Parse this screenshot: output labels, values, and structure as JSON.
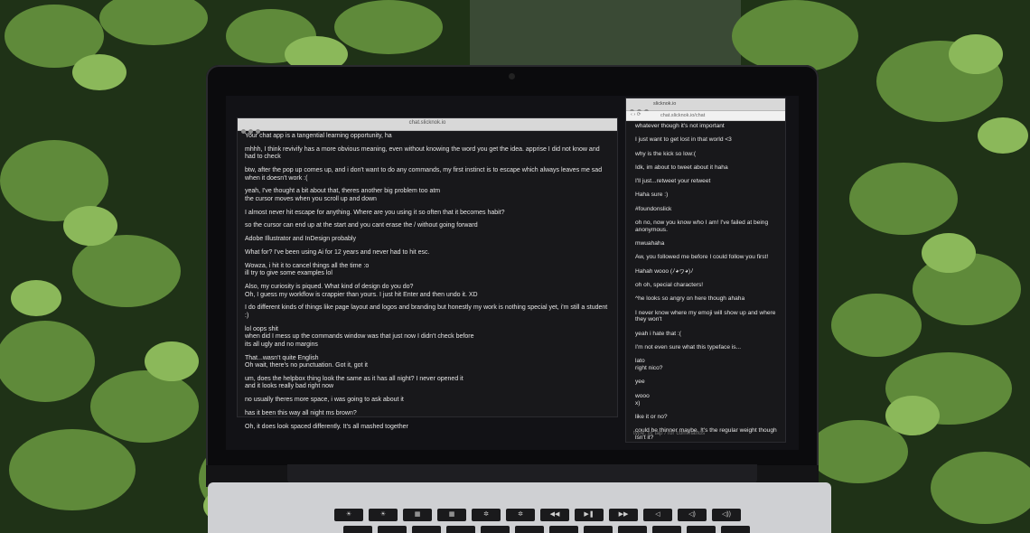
{
  "left_window": {
    "title": "chat.slicknok.io",
    "messages": [
      "Your chat app is a tangential learning opportunity, ha",
      "mhhh, I think revivify has a more obvious meaning, even without knowing the word you get the idea. apprise I did not know and had to check",
      "btw, after the pop up comes up, and i don't want to do any commands, my first instinct is to escape which always leaves me sad when it doesn't work :(",
      "yeah, I've thought a bit about that, theres another big problem too atm\nthe cursor moves when you scroll up and down",
      "I almost never hit escape for anything. Where are you using it so often that it becomes habit?",
      "so the cursor can end up at the start and you cant erase the / without going forward",
      "Adobe Illustrator and InDesign probably",
      "What for? I've been using Ai for 12 years and never had to hit esc.",
      "Wowza, i hit it to cancel things all the time :o\nill try to give some examples lol",
      "Also, my curiosity is piqued. What kind of design do you do?\nOh, I guess my workflow is crappier than yours. I just hit Enter and then undo it. XD",
      "I do different kinds of things like page layout and logos and branding but honestly my work is nothing special yet, i'm still a student :)",
      "lol oops shit\nwhen did I mess up the commands window was that just now I didn't check before\nits all ugly and no margins",
      "That...wasn't quite English\nOh wait, there's no punctuation. Got it, got it",
      "um, does the helpbox thing look the same as it has all night? I never opened it\nand it looks really bad right now",
      "no usually theres more space, i was going to ask about it",
      "has it been this way all night ms brown?",
      "Oh, it does look spaced differently. It's all mashed together"
    ]
  },
  "right_window": {
    "tab_label": "slicknok.io",
    "url": "chat.slicknok.io/chat",
    "messages": [
      "whatever though it's not important",
      "I just want to get lost in that world <3",
      "why is the kick so low:(",
      "Idk, im about to tweet about it haha",
      "I'll just...retweet your retweet",
      "Haha sure :)",
      "#foundonslick",
      "oh no, now you know who I am! I've failed at being anonymous.",
      "mwuahaha",
      "Aw, you followed me before I could follow you first!",
      "Hahah wooo (ﾉ◕ヮ◕)ﾉ",
      "oh oh, special characters!",
      "^he looks so angry on here though ahaha",
      "I never know where my emoji will show up and where they won't",
      "yeah i hate that :(",
      "I'm not even sure what this typeface is...",
      "lato\nright nico?",
      "yee",
      "wooo\nx)",
      "like it or no?",
      "could be thinner maybe. It's the regular weight though isn't it?"
    ],
    "input_placeholder": "type, or tap / for commands"
  }
}
